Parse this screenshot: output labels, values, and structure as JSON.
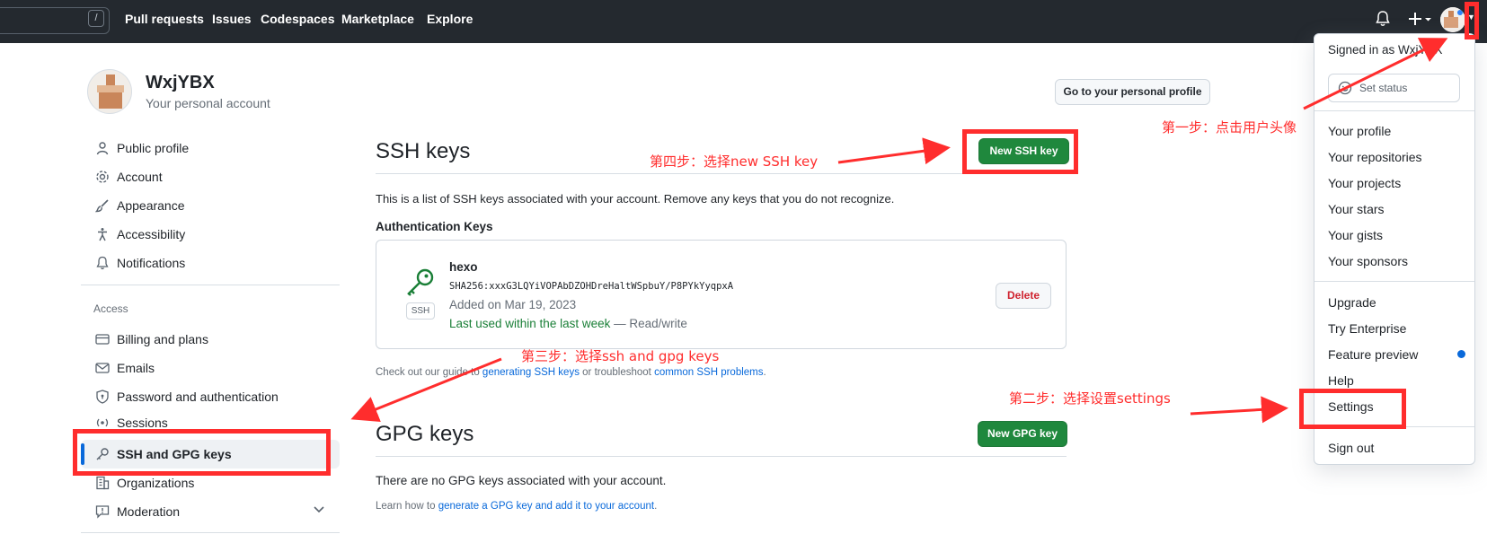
{
  "header": {
    "search_key": "/",
    "nav": [
      "Pull requests",
      "Issues",
      "Codespaces",
      "Marketplace",
      "Explore"
    ],
    "icons": [
      "bell-icon",
      "plus-icon",
      "avatar"
    ]
  },
  "account": {
    "name": "WxjYBX",
    "subtitle": "Your personal account",
    "profile_button": "Go to your personal profile"
  },
  "sidebar": {
    "items": [
      "Public profile",
      "Account",
      "Appearance",
      "Accessibility",
      "Notifications"
    ],
    "access_heading": "Access",
    "access_items": [
      "Billing and plans",
      "Emails",
      "Password and authentication",
      "Sessions",
      "SSH and GPG keys",
      "Organizations",
      "Moderation"
    ],
    "active": "SSH and GPG keys"
  },
  "ssh": {
    "title": "SSH keys",
    "new_button": "New SSH key",
    "description": "This is a list of SSH keys associated with your account. Remove any keys that you do not recognize.",
    "auth_heading": "Authentication Keys",
    "key": {
      "name": "hexo",
      "fingerprint": "SHA256:xxxG3LQYiVOPAbDZOHDreHaltWSpbuY/P8PYkYyqpxA",
      "added": "Added on Mar 19, 2023",
      "last_used": "Last used within the last week",
      "access": "— Read/write",
      "badge": "SSH",
      "delete_button": "Delete"
    },
    "guide_prefix": "Check out our guide to ",
    "guide_link1": "generating SSH keys",
    "guide_middle": " or troubleshoot ",
    "guide_link2": "common SSH problems",
    "guide_suffix": "."
  },
  "gpg": {
    "title": "GPG keys",
    "new_button": "New GPG key",
    "empty": "There are no GPG keys associated with your account.",
    "learn_prefix": "Learn how to ",
    "learn_link": "generate a GPG key and add it to your account",
    "learn_suffix": "."
  },
  "dropdown": {
    "signed_in": "Signed in as WxjYBX",
    "set_status": "Set status",
    "group1": [
      "Your profile",
      "Your repositories",
      "Your projects",
      "Your stars",
      "Your gists",
      "Your sponsors"
    ],
    "group2": [
      "Upgrade",
      "Try Enterprise",
      "Feature preview",
      "Help",
      "Settings"
    ],
    "sign_out": "Sign out"
  },
  "annotations": {
    "step1": "第一步：点击用户头像",
    "step2": "第二步：选择设置settings",
    "step3": "第三步：选择ssh and gpg keys",
    "step4": "第四步：选择new SSH key",
    "color": "#ff2d2d"
  }
}
